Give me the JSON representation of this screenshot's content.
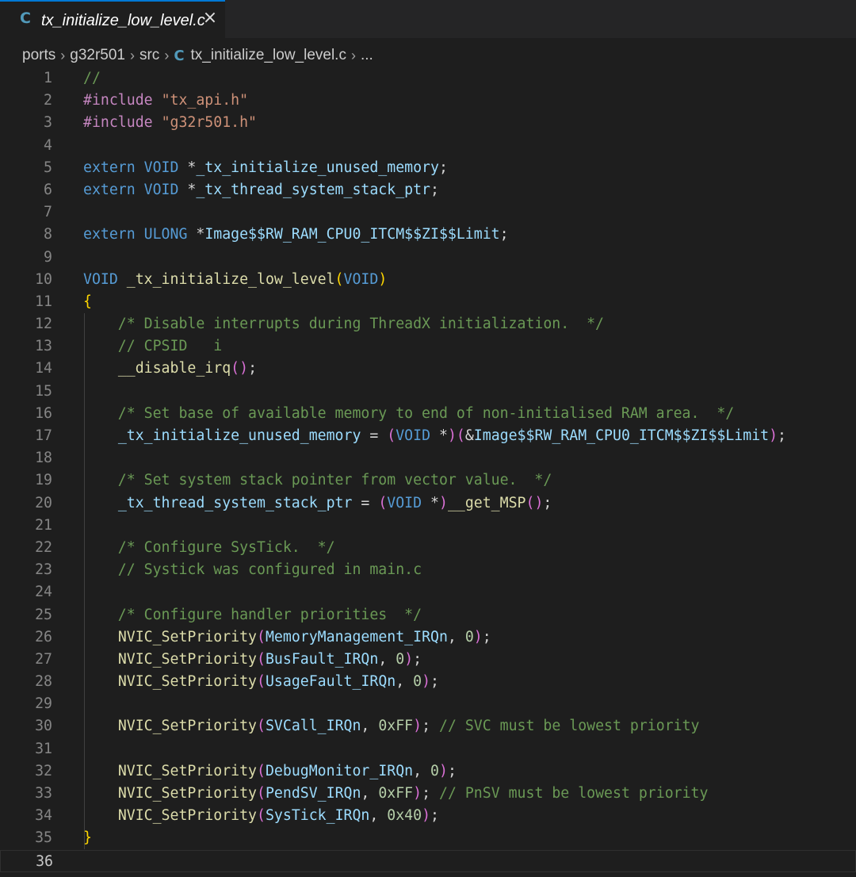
{
  "tab": {
    "icon": "c-file-icon",
    "icon_glyph": "C",
    "title": "tx_initialize_low_level.c",
    "close_glyph": "×"
  },
  "breadcrumb": {
    "items": [
      "ports",
      "g32r501",
      "src",
      "tx_initialize_low_level.c",
      "..."
    ],
    "separator": "›"
  },
  "colors": {
    "background": "#1e1e1e",
    "comment": "#6a9955",
    "preprocessor": "#c586c0",
    "string": "#ce9178",
    "keyword": "#569cd6",
    "function": "#dcdcaa",
    "variable": "#9cdcfe",
    "number": "#b5cea8",
    "bracket_level1": "#ffd700",
    "bracket_level2": "#da70d6"
  },
  "editor": {
    "current_line": 36,
    "lines": [
      {
        "n": "1",
        "tokens": [
          {
            "t": "//",
            "c": "cmt"
          }
        ]
      },
      {
        "n": "2",
        "tokens": [
          {
            "t": "#include ",
            "c": "pp"
          },
          {
            "t": "\"tx_api.h\"",
            "c": "str"
          }
        ]
      },
      {
        "n": "3",
        "tokens": [
          {
            "t": "#include ",
            "c": "pp"
          },
          {
            "t": "\"g32r501.h\"",
            "c": "str"
          }
        ]
      },
      {
        "n": "4",
        "tokens": []
      },
      {
        "n": "5",
        "tokens": [
          {
            "t": "extern ",
            "c": "kw"
          },
          {
            "t": "VOID ",
            "c": "kw"
          },
          {
            "t": "*",
            "c": "pl"
          },
          {
            "t": "_tx_initialize_unused_memory",
            "c": "var"
          },
          {
            "t": ";",
            "c": "pl"
          }
        ]
      },
      {
        "n": "6",
        "tokens": [
          {
            "t": "extern ",
            "c": "kw"
          },
          {
            "t": "VOID ",
            "c": "kw"
          },
          {
            "t": "*",
            "c": "pl"
          },
          {
            "t": "_tx_thread_system_stack_ptr",
            "c": "var"
          },
          {
            "t": ";",
            "c": "pl"
          }
        ]
      },
      {
        "n": "7",
        "tokens": []
      },
      {
        "n": "8",
        "tokens": [
          {
            "t": "extern ",
            "c": "kw"
          },
          {
            "t": "ULONG ",
            "c": "kw"
          },
          {
            "t": "*",
            "c": "pl"
          },
          {
            "t": "Image$$RW_RAM_CPU0_ITCM$$ZI$$Limit",
            "c": "var"
          },
          {
            "t": ";",
            "c": "pl"
          }
        ]
      },
      {
        "n": "9",
        "tokens": []
      },
      {
        "n": "10",
        "tokens": [
          {
            "t": "VOID ",
            "c": "kw"
          },
          {
            "t": "_tx_initialize_low_level",
            "c": "fn"
          },
          {
            "t": "(",
            "c": "brk1"
          },
          {
            "t": "VOID",
            "c": "kw"
          },
          {
            "t": ")",
            "c": "brk1"
          }
        ]
      },
      {
        "n": "11",
        "tokens": [
          {
            "t": "{",
            "c": "brk1"
          }
        ]
      },
      {
        "n": "12",
        "tokens": [
          {
            "t": "    /* Disable interrupts during ThreadX initialization.  */",
            "c": "cmt"
          }
        ]
      },
      {
        "n": "13",
        "tokens": [
          {
            "t": "    // CPSID   i",
            "c": "cmt"
          }
        ]
      },
      {
        "n": "14",
        "tokens": [
          {
            "t": "    ",
            "c": "pl"
          },
          {
            "t": "__disable_irq",
            "c": "fn"
          },
          {
            "t": "()",
            "c": "brk2"
          },
          {
            "t": ";",
            "c": "pl"
          }
        ]
      },
      {
        "n": "15",
        "tokens": []
      },
      {
        "n": "16",
        "tokens": [
          {
            "t": "    /* Set base of available memory to end of non-initialised RAM area.  */",
            "c": "cmt"
          }
        ]
      },
      {
        "n": "17",
        "tokens": [
          {
            "t": "    ",
            "c": "pl"
          },
          {
            "t": "_tx_initialize_unused_memory",
            "c": "var"
          },
          {
            "t": " = ",
            "c": "pl"
          },
          {
            "t": "(",
            "c": "brk2"
          },
          {
            "t": "VOID ",
            "c": "kw"
          },
          {
            "t": "*",
            "c": "pl"
          },
          {
            "t": ")",
            "c": "brk2"
          },
          {
            "t": "(",
            "c": "brk2"
          },
          {
            "t": "&",
            "c": "pl"
          },
          {
            "t": "Image$$RW_RAM_CPU0_ITCM$$ZI$$Limit",
            "c": "var"
          },
          {
            "t": ")",
            "c": "brk2"
          },
          {
            "t": ";",
            "c": "pl"
          }
        ]
      },
      {
        "n": "18",
        "tokens": []
      },
      {
        "n": "19",
        "tokens": [
          {
            "t": "    /* Set system stack pointer from vector value.  */",
            "c": "cmt"
          }
        ]
      },
      {
        "n": "20",
        "tokens": [
          {
            "t": "    ",
            "c": "pl"
          },
          {
            "t": "_tx_thread_system_stack_ptr",
            "c": "var"
          },
          {
            "t": " = ",
            "c": "pl"
          },
          {
            "t": "(",
            "c": "brk2"
          },
          {
            "t": "VOID ",
            "c": "kw"
          },
          {
            "t": "*",
            "c": "pl"
          },
          {
            "t": ")",
            "c": "brk2"
          },
          {
            "t": "__get_MSP",
            "c": "fn"
          },
          {
            "t": "()",
            "c": "brk2"
          },
          {
            "t": ";",
            "c": "pl"
          }
        ]
      },
      {
        "n": "21",
        "tokens": []
      },
      {
        "n": "22",
        "tokens": [
          {
            "t": "    /* Configure SysTick.  */",
            "c": "cmt"
          }
        ]
      },
      {
        "n": "23",
        "tokens": [
          {
            "t": "    // Systick was configured in main.c",
            "c": "cmt"
          }
        ]
      },
      {
        "n": "24",
        "tokens": []
      },
      {
        "n": "25",
        "tokens": [
          {
            "t": "    /* Configure handler priorities  */",
            "c": "cmt"
          }
        ]
      },
      {
        "n": "26",
        "tokens": [
          {
            "t": "    ",
            "c": "pl"
          },
          {
            "t": "NVIC_SetPriority",
            "c": "fn"
          },
          {
            "t": "(",
            "c": "brk2"
          },
          {
            "t": "MemoryManagement_IRQn",
            "c": "var"
          },
          {
            "t": ", ",
            "c": "pl"
          },
          {
            "t": "0",
            "c": "num"
          },
          {
            "t": ")",
            "c": "brk2"
          },
          {
            "t": ";",
            "c": "pl"
          }
        ]
      },
      {
        "n": "27",
        "tokens": [
          {
            "t": "    ",
            "c": "pl"
          },
          {
            "t": "NVIC_SetPriority",
            "c": "fn"
          },
          {
            "t": "(",
            "c": "brk2"
          },
          {
            "t": "BusFault_IRQn",
            "c": "var"
          },
          {
            "t": ", ",
            "c": "pl"
          },
          {
            "t": "0",
            "c": "num"
          },
          {
            "t": ")",
            "c": "brk2"
          },
          {
            "t": ";",
            "c": "pl"
          }
        ]
      },
      {
        "n": "28",
        "tokens": [
          {
            "t": "    ",
            "c": "pl"
          },
          {
            "t": "NVIC_SetPriority",
            "c": "fn"
          },
          {
            "t": "(",
            "c": "brk2"
          },
          {
            "t": "UsageFault_IRQn",
            "c": "var"
          },
          {
            "t": ", ",
            "c": "pl"
          },
          {
            "t": "0",
            "c": "num"
          },
          {
            "t": ")",
            "c": "brk2"
          },
          {
            "t": ";",
            "c": "pl"
          }
        ]
      },
      {
        "n": "29",
        "tokens": []
      },
      {
        "n": "30",
        "tokens": [
          {
            "t": "    ",
            "c": "pl"
          },
          {
            "t": "NVIC_SetPriority",
            "c": "fn"
          },
          {
            "t": "(",
            "c": "brk2"
          },
          {
            "t": "SVCall_IRQn",
            "c": "var"
          },
          {
            "t": ", ",
            "c": "pl"
          },
          {
            "t": "0xFF",
            "c": "num"
          },
          {
            "t": ")",
            "c": "brk2"
          },
          {
            "t": "; ",
            "c": "pl"
          },
          {
            "t": "// SVC must be lowest priority",
            "c": "cmt"
          }
        ]
      },
      {
        "n": "31",
        "tokens": []
      },
      {
        "n": "32",
        "tokens": [
          {
            "t": "    ",
            "c": "pl"
          },
          {
            "t": "NVIC_SetPriority",
            "c": "fn"
          },
          {
            "t": "(",
            "c": "brk2"
          },
          {
            "t": "DebugMonitor_IRQn",
            "c": "var"
          },
          {
            "t": ", ",
            "c": "pl"
          },
          {
            "t": "0",
            "c": "num"
          },
          {
            "t": ")",
            "c": "brk2"
          },
          {
            "t": ";",
            "c": "pl"
          }
        ]
      },
      {
        "n": "33",
        "tokens": [
          {
            "t": "    ",
            "c": "pl"
          },
          {
            "t": "NVIC_SetPriority",
            "c": "fn"
          },
          {
            "t": "(",
            "c": "brk2"
          },
          {
            "t": "PendSV_IRQn",
            "c": "var"
          },
          {
            "t": ", ",
            "c": "pl"
          },
          {
            "t": "0xFF",
            "c": "num"
          },
          {
            "t": ")",
            "c": "brk2"
          },
          {
            "t": "; ",
            "c": "pl"
          },
          {
            "t": "// PnSV must be lowest priority",
            "c": "cmt"
          }
        ]
      },
      {
        "n": "34",
        "tokens": [
          {
            "t": "    ",
            "c": "pl"
          },
          {
            "t": "NVIC_SetPriority",
            "c": "fn"
          },
          {
            "t": "(",
            "c": "brk2"
          },
          {
            "t": "SysTick_IRQn",
            "c": "var"
          },
          {
            "t": ", ",
            "c": "pl"
          },
          {
            "t": "0x40",
            "c": "num"
          },
          {
            "t": ")",
            "c": "brk2"
          },
          {
            "t": ";",
            "c": "pl"
          }
        ]
      },
      {
        "n": "35",
        "tokens": [
          {
            "t": "}",
            "c": "brk1"
          }
        ]
      },
      {
        "n": "36",
        "tokens": []
      }
    ]
  }
}
